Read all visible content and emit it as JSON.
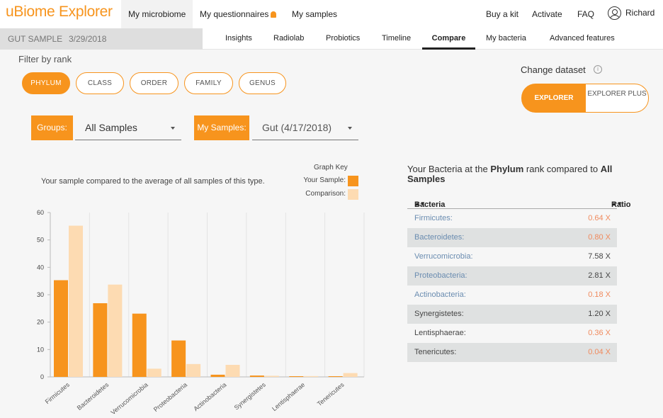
{
  "app": {
    "title": "uBiome Explorer"
  },
  "nav": {
    "left": [
      "My microbiome",
      "My questionnaires",
      "My samples"
    ],
    "right": [
      "Buy a kit",
      "Activate",
      "FAQ"
    ],
    "user": "Richard"
  },
  "sample": {
    "name": "GUT SAMPLE",
    "date": "3/29/2018"
  },
  "subtabs": [
    "Insights",
    "Radiolab",
    "Probiotics",
    "Timeline",
    "Compare",
    "My bacteria",
    "Advanced features"
  ],
  "filter": {
    "label": "Filter by rank",
    "ranks": [
      "PHYLUM",
      "CLASS",
      "ORDER",
      "FAMILY",
      "GENUS"
    ],
    "active": "PHYLUM"
  },
  "dataset": {
    "label": "Change dataset",
    "info_icon": "info-icon",
    "options": [
      "EXPLORER",
      "EXPLORER PLUS"
    ],
    "active": "EXPLORER"
  },
  "selectors": {
    "groups_label": "Groups:",
    "groups_value": "All Samples",
    "samples_label": "My Samples:",
    "samples_value": "Gut (4/17/2018)"
  },
  "chart_desc": "Your sample compared to the average of all samples of this type.",
  "graph_key": {
    "title": "Graph Key",
    "your_sample": "Your Sample:",
    "comparison": "Comparison:"
  },
  "colors": {
    "your_sample": "#f7941d",
    "comparison": "#fddbb2",
    "accent": "#f7941d",
    "low": "#f08a5d"
  },
  "chart_data": {
    "type": "bar",
    "categories": [
      "Firmicutes",
      "Bacteroidetes",
      "Verrucomicrobia",
      "Proteobacteria",
      "Actinobacteria",
      "Synergistetes",
      "Lentisphaerae",
      "Tenericutes"
    ],
    "series": [
      {
        "name": "Your Sample",
        "values": [
          35.3,
          26.9,
          23.1,
          13.3,
          0.8,
          0.5,
          0.1,
          0.1
        ]
      },
      {
        "name": "Comparison",
        "values": [
          55.2,
          33.7,
          3.0,
          4.7,
          4.4,
          0.4,
          0.3,
          1.4
        ]
      }
    ],
    "ylim": [
      0,
      60
    ],
    "yticks": [
      0,
      10,
      20,
      30,
      40,
      50,
      60
    ],
    "grid": true
  },
  "table": {
    "title_pre": "Your Bacteria at the ",
    "title_rank": "Phylum",
    "title_mid": " rank compared to ",
    "title_group": "All Samples",
    "col_bacteria": "Bacteria",
    "col_ratio": "Ratio",
    "rows": [
      {
        "name": "Firmicutes:",
        "ratio": "0.64 X",
        "low": true
      },
      {
        "name": "Bacteroidetes:",
        "ratio": "0.80 X",
        "low": true
      },
      {
        "name": "Verrucomicrobia:",
        "ratio": "7.58 X",
        "low": false
      },
      {
        "name": "Proteobacteria:",
        "ratio": "2.81 X",
        "low": false
      },
      {
        "name": "Actinobacteria:",
        "ratio": "0.18 X",
        "low": true
      },
      {
        "name": "Synergistetes:",
        "ratio": "1.20 X",
        "low": false
      },
      {
        "name": "Lentisphaerae:",
        "ratio": "0.36 X",
        "low": true
      },
      {
        "name": "Tenericutes:",
        "ratio": "0.04 X",
        "low": true
      }
    ]
  }
}
